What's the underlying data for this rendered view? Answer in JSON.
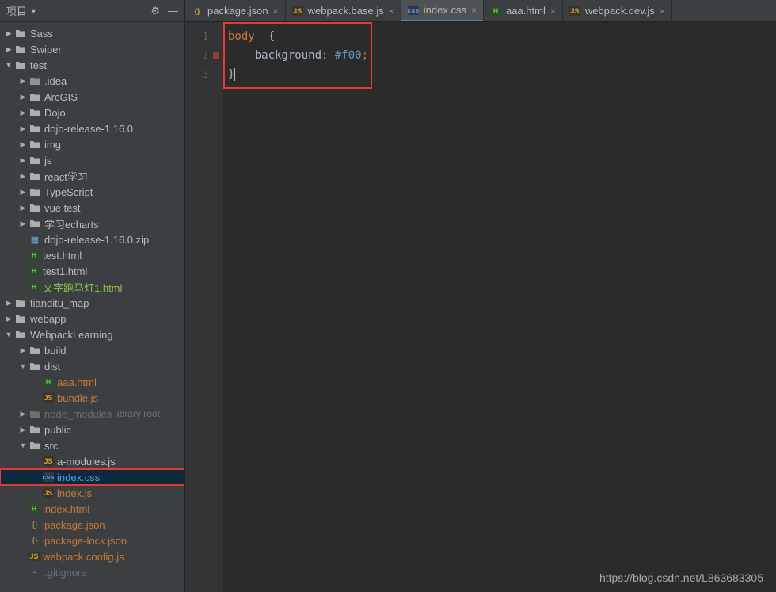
{
  "sidebar": {
    "title": "项目",
    "gear_icon": "gear-icon",
    "collapse_icon": "collapse-icon",
    "tree": [
      {
        "depth": 0,
        "chev": "right",
        "icon": "folder",
        "label": "Sass"
      },
      {
        "depth": 0,
        "chev": "right",
        "icon": "folder",
        "label": "Swiper"
      },
      {
        "depth": 0,
        "chev": "down",
        "icon": "folder",
        "label": "test"
      },
      {
        "depth": 1,
        "chev": "right",
        "icon": "folder-dark",
        "label": ".idea"
      },
      {
        "depth": 1,
        "chev": "right",
        "icon": "folder",
        "label": "ArcGIS"
      },
      {
        "depth": 1,
        "chev": "right",
        "icon": "folder",
        "label": "Dojo"
      },
      {
        "depth": 1,
        "chev": "right",
        "icon": "folder",
        "label": "dojo-release-1.16.0"
      },
      {
        "depth": 1,
        "chev": "right",
        "icon": "folder",
        "label": "img"
      },
      {
        "depth": 1,
        "chev": "right",
        "icon": "folder",
        "label": "js"
      },
      {
        "depth": 1,
        "chev": "right",
        "icon": "folder",
        "label": "react学习"
      },
      {
        "depth": 1,
        "chev": "right",
        "icon": "folder",
        "label": "TypeScript"
      },
      {
        "depth": 1,
        "chev": "right",
        "icon": "folder",
        "label": "vue test"
      },
      {
        "depth": 1,
        "chev": "right",
        "icon": "folder",
        "label": "学习echarts"
      },
      {
        "depth": 1,
        "chev": "none",
        "icon": "zip",
        "label": "dojo-release-1.16.0.zip"
      },
      {
        "depth": 1,
        "chev": "none",
        "icon": "html",
        "label": "test.html"
      },
      {
        "depth": 1,
        "chev": "none",
        "icon": "html",
        "label": "test1.html"
      },
      {
        "depth": 1,
        "chev": "none",
        "icon": "html",
        "label": "文字跑马灯1.html",
        "cls": "green"
      },
      {
        "depth": 0,
        "chev": "right",
        "icon": "folder",
        "label": "tianditu_map"
      },
      {
        "depth": 0,
        "chev": "right",
        "icon": "folder",
        "label": "webapp"
      },
      {
        "depth": 0,
        "chev": "down",
        "icon": "folder",
        "label": "WebpackLearning"
      },
      {
        "depth": 1,
        "chev": "right",
        "icon": "folder",
        "label": "build"
      },
      {
        "depth": 1,
        "chev": "down",
        "icon": "folder",
        "label": "dist"
      },
      {
        "depth": 2,
        "chev": "none",
        "icon": "html",
        "label": "aaa.html",
        "cls": "orange"
      },
      {
        "depth": 2,
        "chev": "none",
        "icon": "js",
        "label": "bundle.js",
        "cls": "orange"
      },
      {
        "depth": 1,
        "chev": "right",
        "icon": "folder-muted",
        "label": "node_modules",
        "cls": "muted",
        "suffix": "library root"
      },
      {
        "depth": 1,
        "chev": "right",
        "icon": "folder",
        "label": "public"
      },
      {
        "depth": 1,
        "chev": "down",
        "icon": "folder",
        "label": "src"
      },
      {
        "depth": 2,
        "chev": "none",
        "icon": "js",
        "label": "a-modules.js"
      },
      {
        "depth": 2,
        "chev": "none",
        "icon": "css",
        "label": "index.css",
        "cls": "highlighted-blue",
        "selected": true,
        "redbox": true
      },
      {
        "depth": 2,
        "chev": "none",
        "icon": "js",
        "label": "index.js",
        "cls": "orange"
      },
      {
        "depth": 1,
        "chev": "none",
        "icon": "html",
        "label": "index.html",
        "cls": "orange"
      },
      {
        "depth": 1,
        "chev": "none",
        "icon": "json",
        "label": "package.json",
        "cls": "orange"
      },
      {
        "depth": 1,
        "chev": "none",
        "icon": "json",
        "label": "package-lock.json",
        "cls": "orange"
      },
      {
        "depth": 1,
        "chev": "none",
        "icon": "js",
        "label": "webpack.config.js",
        "cls": "orange"
      },
      {
        "depth": 1,
        "chev": "none",
        "icon": "file",
        "label": ".gitignore",
        "cls": "muted"
      }
    ]
  },
  "tabs": [
    {
      "icon": "json",
      "label": "package.json",
      "active": false
    },
    {
      "icon": "js",
      "label": "webpack.base.js",
      "active": false
    },
    {
      "icon": "css",
      "label": "index.css",
      "active": true
    },
    {
      "icon": "html",
      "label": "aaa.html",
      "active": false
    },
    {
      "icon": "js",
      "label": "webpack.dev.js",
      "active": false
    }
  ],
  "editor": {
    "lines": [
      {
        "n": 1,
        "bp": false,
        "tokens": [
          [
            "sel",
            "body  "
          ],
          [
            "brace",
            "{"
          ]
        ]
      },
      {
        "n": 2,
        "bp": true,
        "tokens": [
          [
            "prop",
            "    background"
          ],
          [
            "colon",
            ": "
          ],
          [
            "val",
            "#f00"
          ],
          [
            "semi",
            ";"
          ]
        ]
      },
      {
        "n": 3,
        "bp": false,
        "tokens": [
          [
            "brace",
            "}"
          ]
        ],
        "caret": true
      }
    ]
  },
  "watermark": "https://blog.csdn.net/L863683305"
}
